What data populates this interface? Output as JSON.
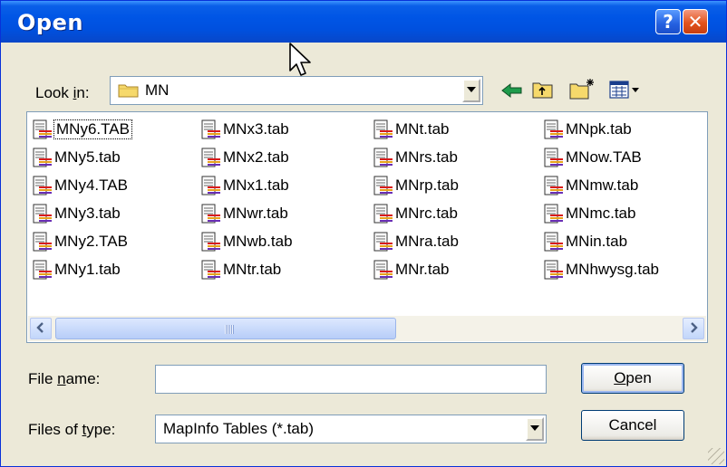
{
  "window": {
    "title": "Open",
    "help_label": "?",
    "close_label": "✕"
  },
  "look_in": {
    "label_prefix": "Look ",
    "label_accel": "i",
    "label_suffix": "n:",
    "value": "MN"
  },
  "toolbar": {
    "back_icon": "back-arrow-icon",
    "up_icon": "up-folder-icon",
    "new_folder_icon": "new-folder-icon",
    "view_menu_icon": "view-menu-icon"
  },
  "files": {
    "columns": [
      [
        "MNy6.TAB",
        "MNy5.tab",
        "MNy4.TAB",
        "MNy3.tab",
        "MNy2.TAB",
        "MNy1.tab"
      ],
      [
        "MNx3.tab",
        "MNx2.tab",
        "MNx1.tab",
        "MNwr.tab",
        "MNwb.tab",
        "MNtr.tab"
      ],
      [
        "MNt.tab",
        "MNrs.tab",
        "MNrp.tab",
        "MNrc.tab",
        "MNra.tab",
        "MNr.tab"
      ],
      [
        "MNpk.tab",
        "MNow.TAB",
        "MNmw.tab",
        "MNmc.tab",
        "MNin.tab",
        "MNhwysg.tab"
      ]
    ],
    "focused": "MNy6.TAB"
  },
  "file_name": {
    "label_prefix": "File ",
    "label_accel": "n",
    "label_suffix": "ame:",
    "value": ""
  },
  "file_type": {
    "label_prefix": "Files of ",
    "label_accel": "t",
    "label_suffix": "ype:",
    "value": "MapInfo Tables (*.tab)"
  },
  "buttons": {
    "open_accel": "O",
    "open_rest": "pen",
    "cancel": "Cancel"
  },
  "colors": {
    "titlebar": "#0055E5",
    "dialog_bg": "#ECE9D8",
    "close_red": "#E3531C"
  }
}
